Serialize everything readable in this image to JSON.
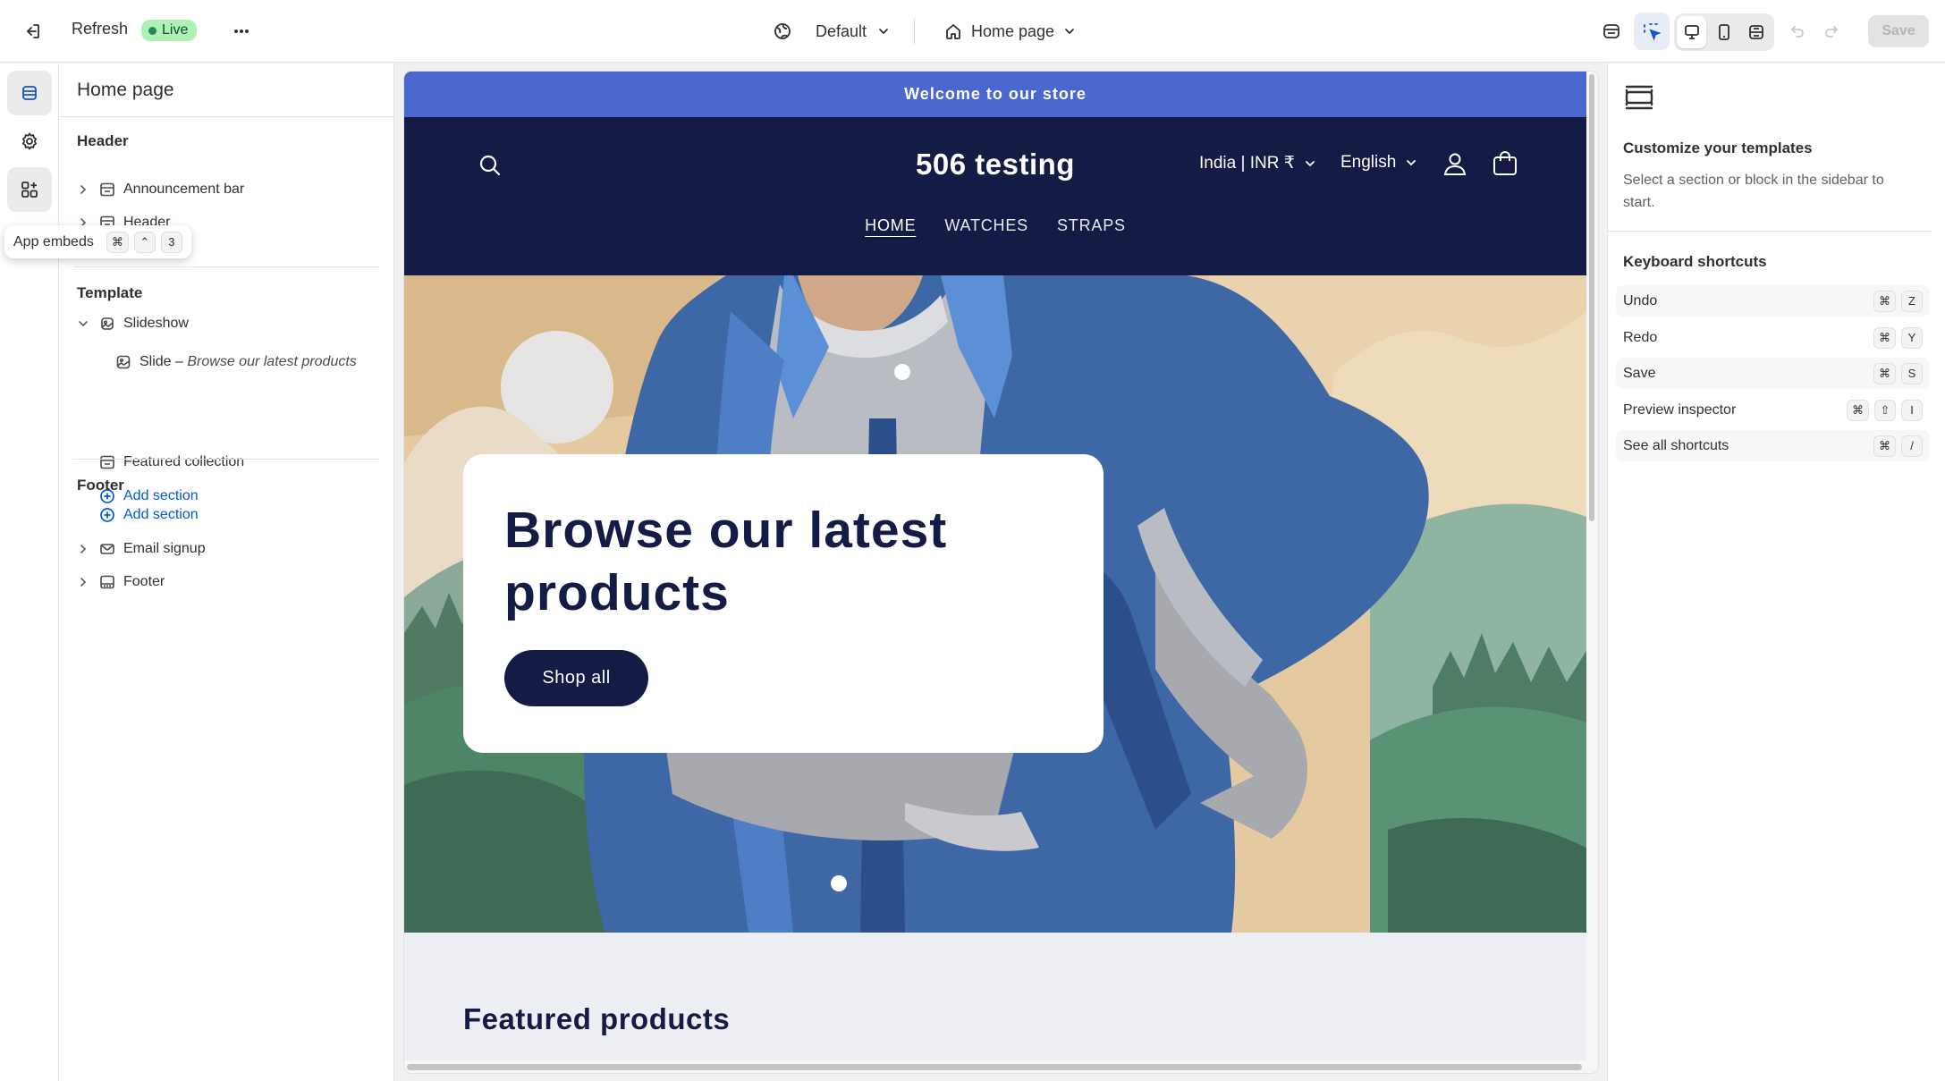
{
  "topbar": {
    "refresh_label": "Refresh",
    "live_label": "Live",
    "theme_label": "Default",
    "page_label": "Home page",
    "save_label": "Save"
  },
  "sidebar": {
    "title": "Home page",
    "header_group": "Header",
    "header_items": [
      {
        "label": "Announcement bar"
      },
      {
        "label": "Header"
      }
    ],
    "template_group": "Template",
    "slideshow": "Slideshow",
    "slide_label": "Slide – ",
    "slide_detail": "Browse our latest products",
    "featured_collection": "Featured collection",
    "add_section": "Add section",
    "footer_group": "Footer",
    "footer_items": [
      {
        "label": "Email signup"
      },
      {
        "label": "Footer"
      }
    ]
  },
  "tooltip": {
    "label": "App embeds",
    "keys": [
      "⌘",
      "⌃",
      "3"
    ]
  },
  "preview": {
    "announcement": "Welcome to our store",
    "store_name": "506 testing",
    "currency": "India | INR ₹",
    "language": "English",
    "nav": [
      "HOME",
      "WATCHES",
      "STRAPS"
    ],
    "hero_title": "Browse our latest products",
    "hero_button": "Shop all",
    "featured_title": "Featured products"
  },
  "rightpanel": {
    "title": "Customize your templates",
    "description": "Select a section or block in the sidebar to start.",
    "shortcuts_title": "Keyboard shortcuts",
    "shortcuts": [
      {
        "label": "Undo",
        "keys": [
          "⌘",
          "Z"
        ]
      },
      {
        "label": "Redo",
        "keys": [
          "⌘",
          "Y"
        ]
      },
      {
        "label": "Save",
        "keys": [
          "⌘",
          "S"
        ]
      },
      {
        "label": "Preview inspector",
        "keys": [
          "⌘",
          "⇧",
          "I"
        ]
      },
      {
        "label": "See all shortcuts",
        "keys": [
          "⌘",
          "/"
        ]
      }
    ]
  },
  "colors": {
    "announcement_bg": "#4a67d0",
    "nav_bg": "#141b45",
    "live_badge": "#aff0b5",
    "link": "#005bd3"
  }
}
